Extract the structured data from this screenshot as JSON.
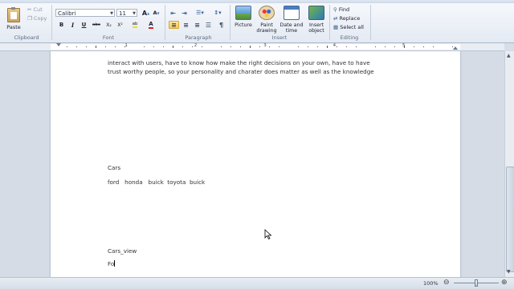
{
  "ribbon": {
    "clipboard": {
      "paste": "Paste",
      "cut": "Cut",
      "copy": "Copy",
      "label": "Clipboard"
    },
    "font": {
      "family": "Calibri",
      "size": "11",
      "label": "Font",
      "grow": "A",
      "shrink": "A",
      "bold": "B",
      "italic": "I",
      "underline": "U",
      "strike": "abc",
      "highlight": "ab",
      "color": "A"
    },
    "paragraph": {
      "label": "Paragraph"
    },
    "insert": {
      "label": "Insert",
      "picture": "Picture",
      "paint_line1": "Paint",
      "paint_line2": "drawing",
      "datetime_line1": "Date and",
      "datetime_line2": "time",
      "object_line1": "Insert",
      "object_line2": "object"
    },
    "editing": {
      "label": "Editing",
      "find": "Find",
      "replace": "Replace",
      "select_all": "Select all"
    }
  },
  "ruler_numbers": [
    "1",
    "2",
    "3",
    "4",
    "5",
    "6"
  ],
  "document": {
    "line1": "interact with users, have to know how make the right decisions on your own, have to have",
    "line2": "trust worthy people, so your personality and charater does matter as well as the knowledge",
    "heading1": "Cars",
    "cars_line": "ford   honda   buick  toyota  buick",
    "heading2": "Cars_view",
    "typing": "Fo"
  },
  "status": {
    "zoom": "100%"
  }
}
